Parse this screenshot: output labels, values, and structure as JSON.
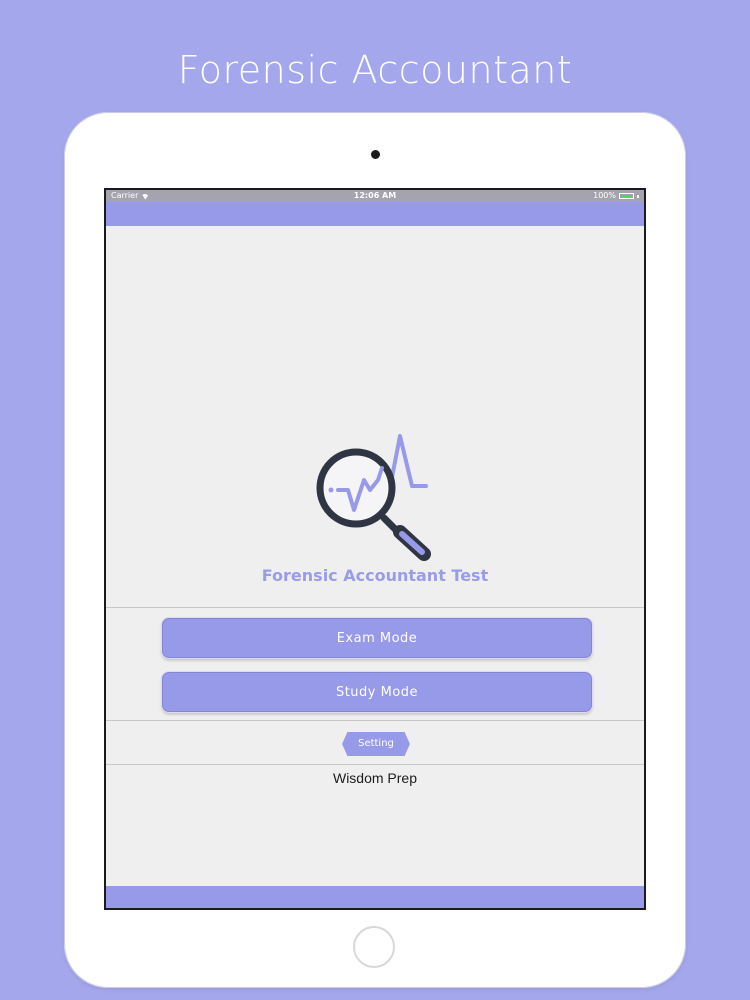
{
  "promo": {
    "title": "Forensic Accountant"
  },
  "status_bar": {
    "carrier": "Carrier",
    "time": "12:06 AM",
    "battery": "100%",
    "icons": [
      "wifi-icon",
      "battery-icon"
    ]
  },
  "app": {
    "title": "Forensic Accountant Test",
    "logo_icon": "magnifier-chart-icon",
    "buttons": {
      "exam_mode": "Exam Mode",
      "study_mode": "Study Mode",
      "setting": "Setting"
    },
    "brand": "Wisdom Prep"
  },
  "colors": {
    "background": "#a5a7ec",
    "accent": "#9799e9",
    "screen_bg": "#efeff0",
    "title_text": "#9a9ce8",
    "battery_fill": "#49d659"
  }
}
